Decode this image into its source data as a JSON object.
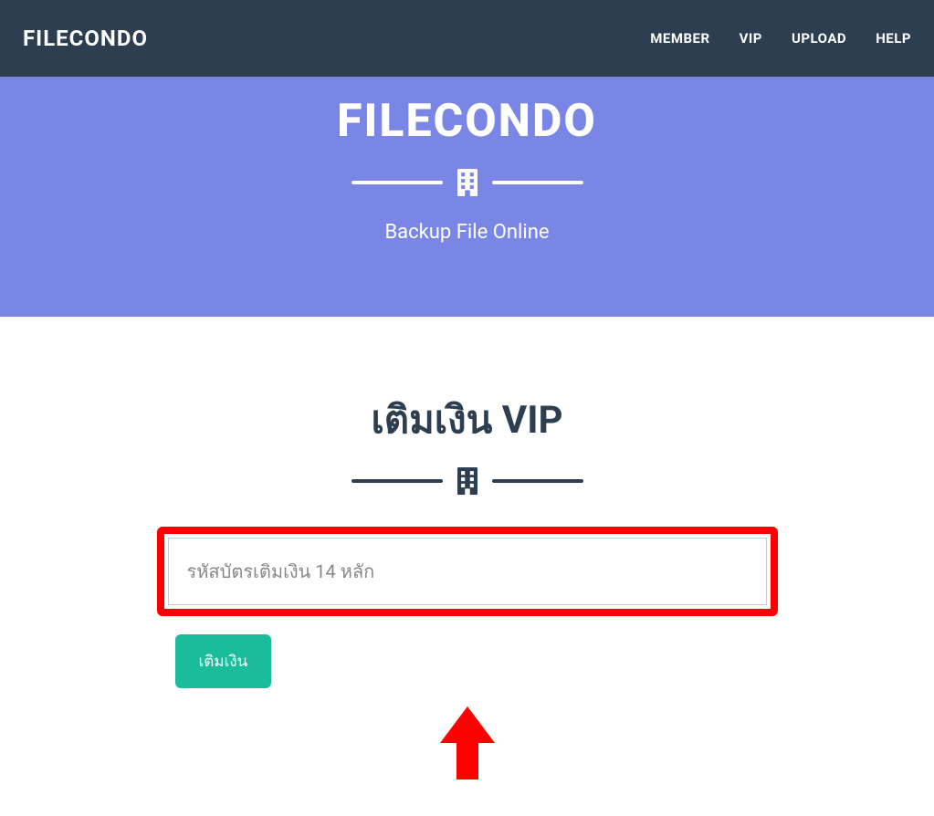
{
  "navbar": {
    "brand": "FILECONDO",
    "links": [
      {
        "label": "MEMBER"
      },
      {
        "label": "VIP"
      },
      {
        "label": "UPLOAD"
      },
      {
        "label": "HELP"
      }
    ]
  },
  "hero": {
    "title": "FILECONDO",
    "subtitle": "Backup File Online"
  },
  "main": {
    "title": "เติมเงิน VIP",
    "input_placeholder": "รหัสบัตรเติมเงิน 14 หลัก",
    "button_label": "เติมเงิน"
  },
  "colors": {
    "navbar_bg": "#2c3e50",
    "hero_bg": "#7986e5",
    "accent": "#1abc9c",
    "highlight": "#ff0000"
  }
}
